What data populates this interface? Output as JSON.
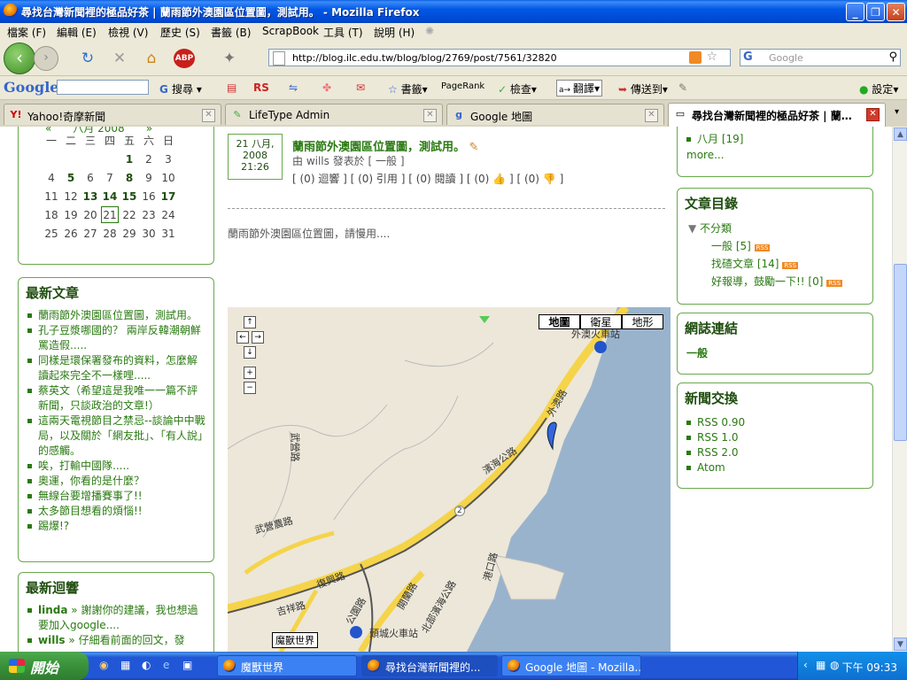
{
  "window": {
    "title": "尋找台灣新聞裡的極品好茶 | 蘭雨節外澳園區位置圖，測試用。 - Mozilla Firefox"
  },
  "menu": [
    "檔案 (F)",
    "編輯 (E)",
    "檢視 (V)",
    "歷史 (S)",
    "書籤 (B)",
    "ScrapBook",
    "工具 (T)",
    "說明 (H)"
  ],
  "nav": {
    "url": "http://blog.ilc.edu.tw/blog/blog/2769/post/7561/32820",
    "search_placeholder": "Google",
    "search_engine": "G"
  },
  "google_toolbar": {
    "logo": "Google",
    "search_label": "搜尋",
    "rs": "RS",
    "bookmarks": "書籤",
    "pagerank": "PageRank",
    "check": "檢查",
    "translate": "翻譯",
    "sendto": "傳送到",
    "settings": "設定"
  },
  "tabs": [
    {
      "label": "Yahoo!奇摩新聞",
      "icon": "Y!"
    },
    {
      "label": "LifeType Admin",
      "icon": "✎"
    },
    {
      "label": "Google 地圖",
      "icon": "g"
    },
    {
      "label": "尋找台灣新聞裡的極品好茶 | 蘭…",
      "icon": "▭"
    }
  ],
  "calendar": {
    "header": "«　　八月 2008　　»",
    "weekdays": [
      "一",
      "二",
      "三",
      "四",
      "五",
      "六",
      "日"
    ],
    "weeks": [
      [
        "",
        "",
        "",
        "",
        "1",
        "2",
        "3"
      ],
      [
        "4",
        "5",
        "6",
        "7",
        "8",
        "9",
        "10"
      ],
      [
        "11",
        "12",
        "13",
        "14",
        "15",
        "16",
        "17"
      ],
      [
        "18",
        "19",
        "20",
        "21",
        "22",
        "23",
        "24"
      ],
      [
        "25",
        "26",
        "27",
        "28",
        "29",
        "30",
        "31"
      ]
    ],
    "bold_days": [
      "1",
      "5",
      "8",
      "13",
      "14",
      "15",
      "17"
    ],
    "today": "21"
  },
  "recent_posts": {
    "title": "最新文章",
    "items": [
      "蘭雨節外澳園區位置圖，測試用。",
      "孔子豆漿哪國的？ 兩岸反韓潮朝鮮罵造假.....",
      "同樣是環保署發布的資料，怎麼解讀起來完全不一樣哩.....",
      "蔡英文（希望這是我唯一一篇不評新聞，只談政治的文章!）",
      "這兩天電視節目之禁忌--談論中中戰局，以及關於「網友批」、「有人說」的感觸。",
      "唉，打輸中國隊.....",
      "奧運，你看的是什麼？",
      "無線台要增播賽事了!!",
      "太多節目想看的煩惱!!",
      "踢爆!?"
    ]
  },
  "recent_comments": {
    "title": "最新迴響",
    "items": [
      {
        "author": "linda",
        "text": "謝謝你的建議，我也想過要加入google...."
      },
      {
        "author": "wills",
        "text": "仔細看前面的回文，發"
      }
    ]
  },
  "post": {
    "date_day": "21 八月,",
    "date_year": "2008",
    "date_time": "21:26",
    "title": "蘭雨節外澳園區位置圖，測試用。",
    "byline": "由 wills 發表於 [ 一般 ]",
    "actions": "[ (0) 迴響 ] [ (0) 引用 ] [ (0) 閱讀 ] [ (0)",
    "actions_mid": "] [ (0)",
    "actions_end": "]",
    "body": "蘭雨節外澳園區位置圖，請慢用...."
  },
  "map": {
    "types": [
      "地圖",
      "衛星",
      "地形"
    ],
    "labels": [
      "外澳火車站",
      "頭城火車站",
      "濱海公路",
      "外澳路",
      "武營路",
      "武營農路",
      "復興路",
      "吉祥路",
      "公園路",
      "開蘭路",
      "北部濱海公路",
      "港口路"
    ],
    "route": "2",
    "scale": "魔獸世界"
  },
  "archives": {
    "year": "2008",
    "month": "八月 [19]",
    "more": "more..."
  },
  "categories": {
    "title": "文章目錄",
    "root": "不分類",
    "items": [
      "一般 [5]",
      "找碴文章 [14]",
      "好報導，鼓勵一下!! [0]"
    ],
    "rss": "RSS"
  },
  "links": {
    "title": "網誌連結",
    "item": "一般"
  },
  "feeds": {
    "title": "新聞交換",
    "items": [
      "RSS 0.90",
      "RSS 1.0",
      "RSS 2.0",
      "Atom"
    ]
  },
  "taskbar": {
    "start": "開始",
    "tasks": [
      "魔獸世界",
      "尋找台灣新聞裡的...",
      "Google 地圖 - Mozilla..."
    ],
    "clock": "下午 09:33"
  }
}
